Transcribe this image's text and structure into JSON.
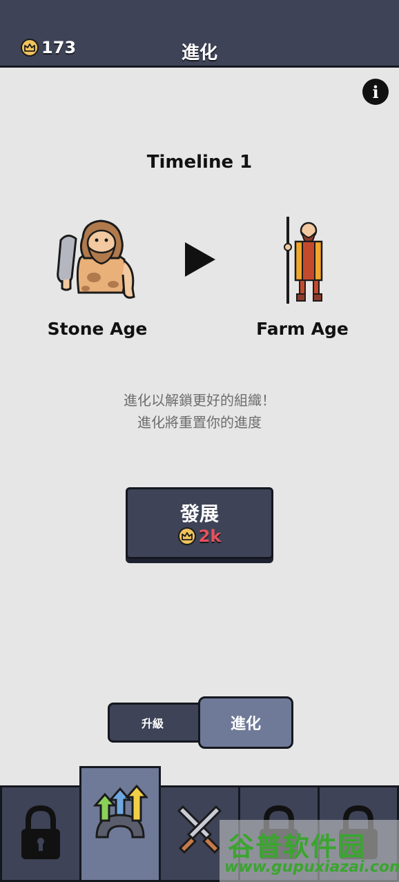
{
  "header": {
    "crowns": "173",
    "title": "進化",
    "crown_icon": "crown-coin-icon"
  },
  "info_icon_glyph": "i",
  "timeline_label": "Timeline 1",
  "ages": {
    "from": {
      "name": "Stone Age",
      "icon": "caveman-icon"
    },
    "to": {
      "name": "Farm Age",
      "icon": "farmer-icon"
    }
  },
  "arrow_icon": "play-arrow-icon",
  "messages": {
    "line1": "進化以解鎖更好的組織！",
    "line2": "進化將重置你的進度"
  },
  "develop_button": {
    "label": "發展",
    "cost": "2k"
  },
  "toggle": {
    "left_label": "升級",
    "right_label": "進化",
    "selected": "進化"
  },
  "tabs": [
    {
      "icon": "lock-icon",
      "locked": true
    },
    {
      "icon": "evolution-arrows-icon",
      "active": true
    },
    {
      "icon": "crossed-swords-icon"
    },
    {
      "icon": "lock-icon",
      "locked": true
    },
    {
      "icon": "lock-icon",
      "locked": true
    }
  ],
  "watermark": {
    "name": "谷普软件园",
    "url": "www.gupuxiazai.com"
  },
  "colors": {
    "header_bg": "#3e4357",
    "active_bg": "#6f7a98",
    "coin": "#f0c25c",
    "cost_text": "#e8505b",
    "background": "#e6e6e6"
  }
}
